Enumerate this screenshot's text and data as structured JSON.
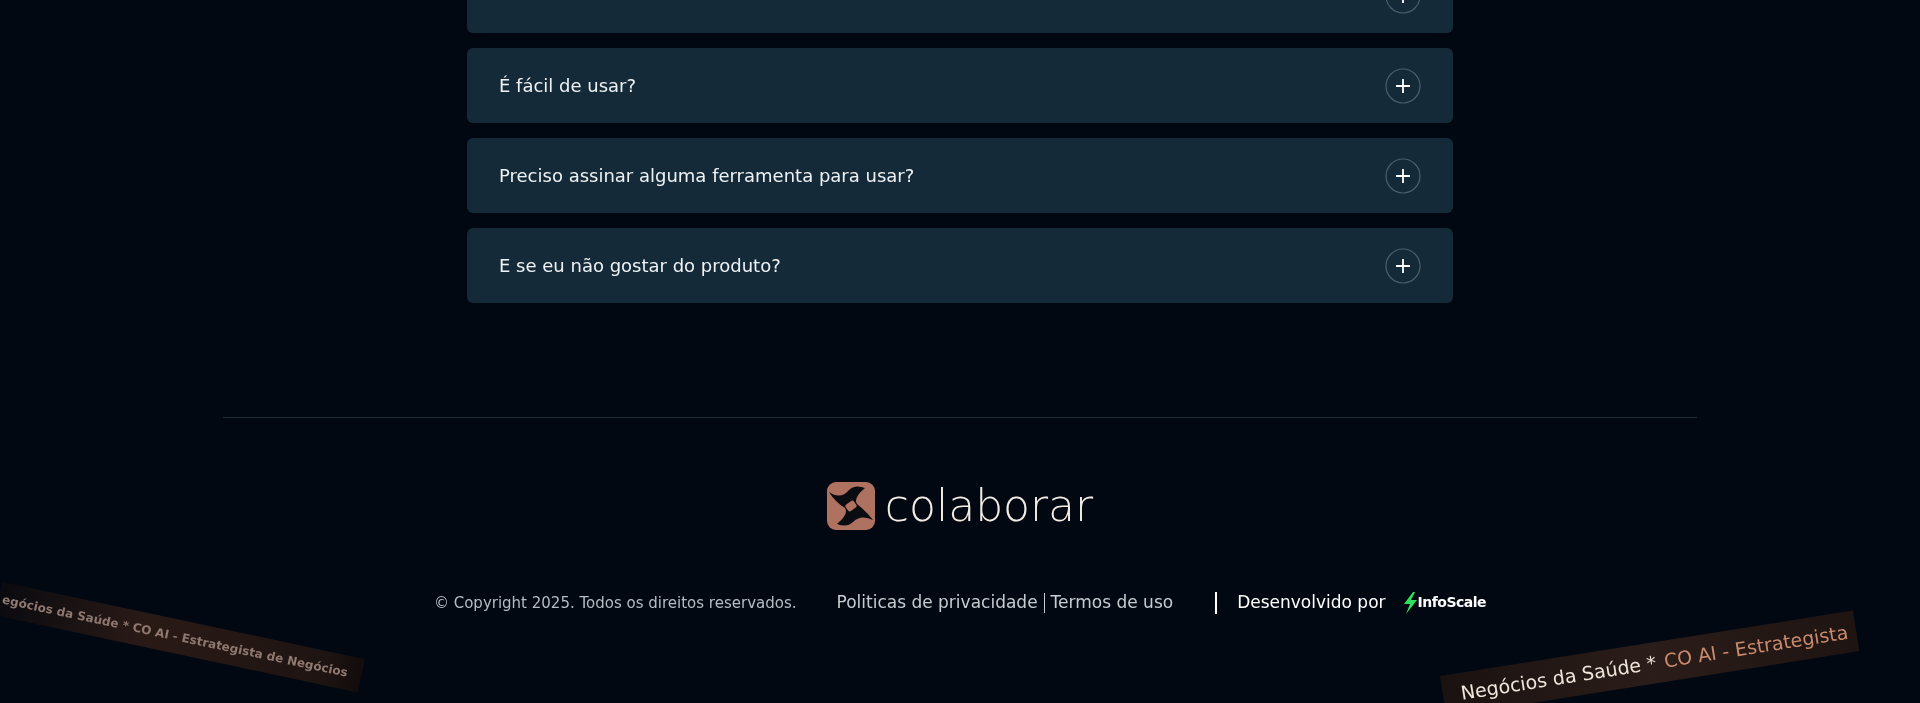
{
  "faq": [
    {
      "expanded": false
    },
    {
      "question": "É fácil de usar?",
      "expanded": false
    },
    {
      "question": "Preciso assinar alguma ferramenta para usar?",
      "expanded": false
    },
    {
      "question": "E se eu não gostar do produto?",
      "expanded": false
    }
  ],
  "footer": {
    "brand": "colaborar",
    "copyright": "© Copyright 2025. Todos os direitos reservados.",
    "links": [
      "Politicas de privacidade",
      "Termos de uso"
    ],
    "developed_by": "Desenvolvido por",
    "developer": "InfoScale"
  },
  "banners": [
    {
      "segments": [
        {
          "text": "egócios da Saúde * CO AI - Estrategista de Negócios",
          "kind": "muted"
        }
      ]
    },
    {
      "segments": [
        {
          "text": "Negócios da Saúde *",
          "kind": "plain"
        },
        {
          "text": "CO AI - Estrategista",
          "kind": "accent"
        }
      ]
    }
  ]
}
